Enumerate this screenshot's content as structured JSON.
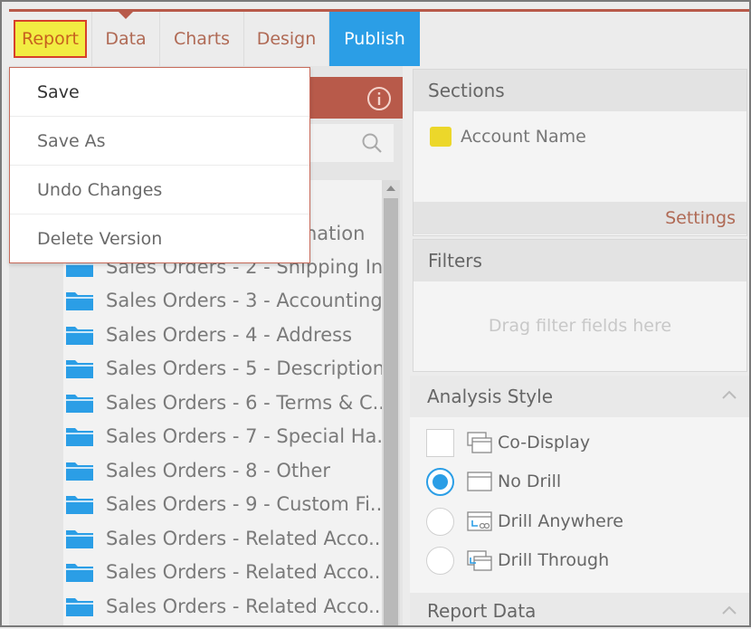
{
  "nav": {
    "report": "Report",
    "data": "Data",
    "charts": "Charts",
    "design": "Design",
    "publish": "Publish"
  },
  "report_menu": {
    "items": [
      "Save",
      "Save As",
      "Undo Changes",
      "Delete Version"
    ]
  },
  "data_tree": {
    "partial_item": "nation",
    "items": [
      "Sales Orders - 2 - Shipping In...",
      "Sales Orders - 3 - Accounting",
      "Sales Orders - 4 - Address",
      "Sales Orders - 5 - Description",
      "Sales Orders - 6 - Terms & C...",
      "Sales Orders - 7 - Special Ha...",
      "Sales Orders - 8 - Other",
      "Sales Orders - 9 - Custom Fi...",
      "Sales Orders - Related Acco...",
      "Sales Orders - Related Acco...",
      "Sales Orders - Related Acco..."
    ]
  },
  "sections": {
    "title": "Sections",
    "field": "Account Name",
    "field_color": "#ecd72a",
    "settings": "Settings"
  },
  "filters": {
    "title": "Filters",
    "placeholder": "Drag filter fields here"
  },
  "analysis_style": {
    "title": "Analysis Style",
    "co_display": "Co-Display",
    "options": [
      "No Drill",
      "Drill Anywhere",
      "Drill Through"
    ],
    "selected": "No Drill"
  },
  "report_data": {
    "title": "Report Data"
  },
  "colors": {
    "accent_red": "#b85a4a",
    "publish_blue": "#2b9ee6",
    "highlight_yellow": "#f2ec42"
  }
}
